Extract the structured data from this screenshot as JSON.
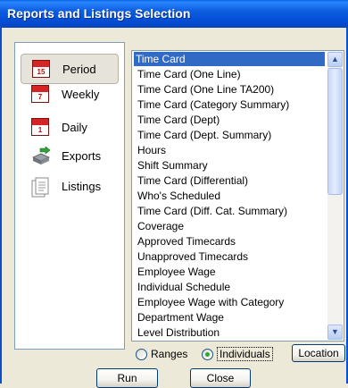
{
  "window": {
    "title": "Reports and Listings Selection"
  },
  "nav": {
    "items": [
      {
        "label": "Period",
        "icon": "calendar-period-icon",
        "badge": "15",
        "active": true
      },
      {
        "label": "Weekly",
        "icon": "calendar-weekly-icon",
        "badge": "7",
        "active": false
      },
      {
        "label": "Daily",
        "icon": "calendar-daily-icon",
        "badge": "1",
        "active": false
      },
      {
        "label": "Exports",
        "icon": "export-icon",
        "active": false
      },
      {
        "label": "Listings",
        "icon": "listing-document-icon",
        "active": false
      }
    ]
  },
  "reports": {
    "selected_index": 0,
    "items": [
      "Time Card",
      "Time Card (One Line)",
      "Time Card (One Line TA200)",
      "Time Card (Category Summary)",
      "Time Card (Dept)",
      "Time Card (Dept. Summary)",
      "Hours",
      "Shift Summary",
      "Time Card (Differential)",
      "Who's Scheduled",
      "Time Card (Diff. Cat. Summary)",
      "Coverage",
      "Approved Timecards",
      "Unapproved Timecards",
      "Employee Wage",
      "Individual Schedule",
      "Employee Wage with Category",
      "Department Wage",
      "Level Distribution"
    ]
  },
  "filter": {
    "ranges_label": "Ranges",
    "individuals_label": "Individuals",
    "selected": "Individuals",
    "location_label": "Location"
  },
  "actions": {
    "run_label": "Run",
    "close_label": "Close"
  },
  "colors": {
    "title_bar": "#0550d8",
    "selection": "#316ac5"
  }
}
